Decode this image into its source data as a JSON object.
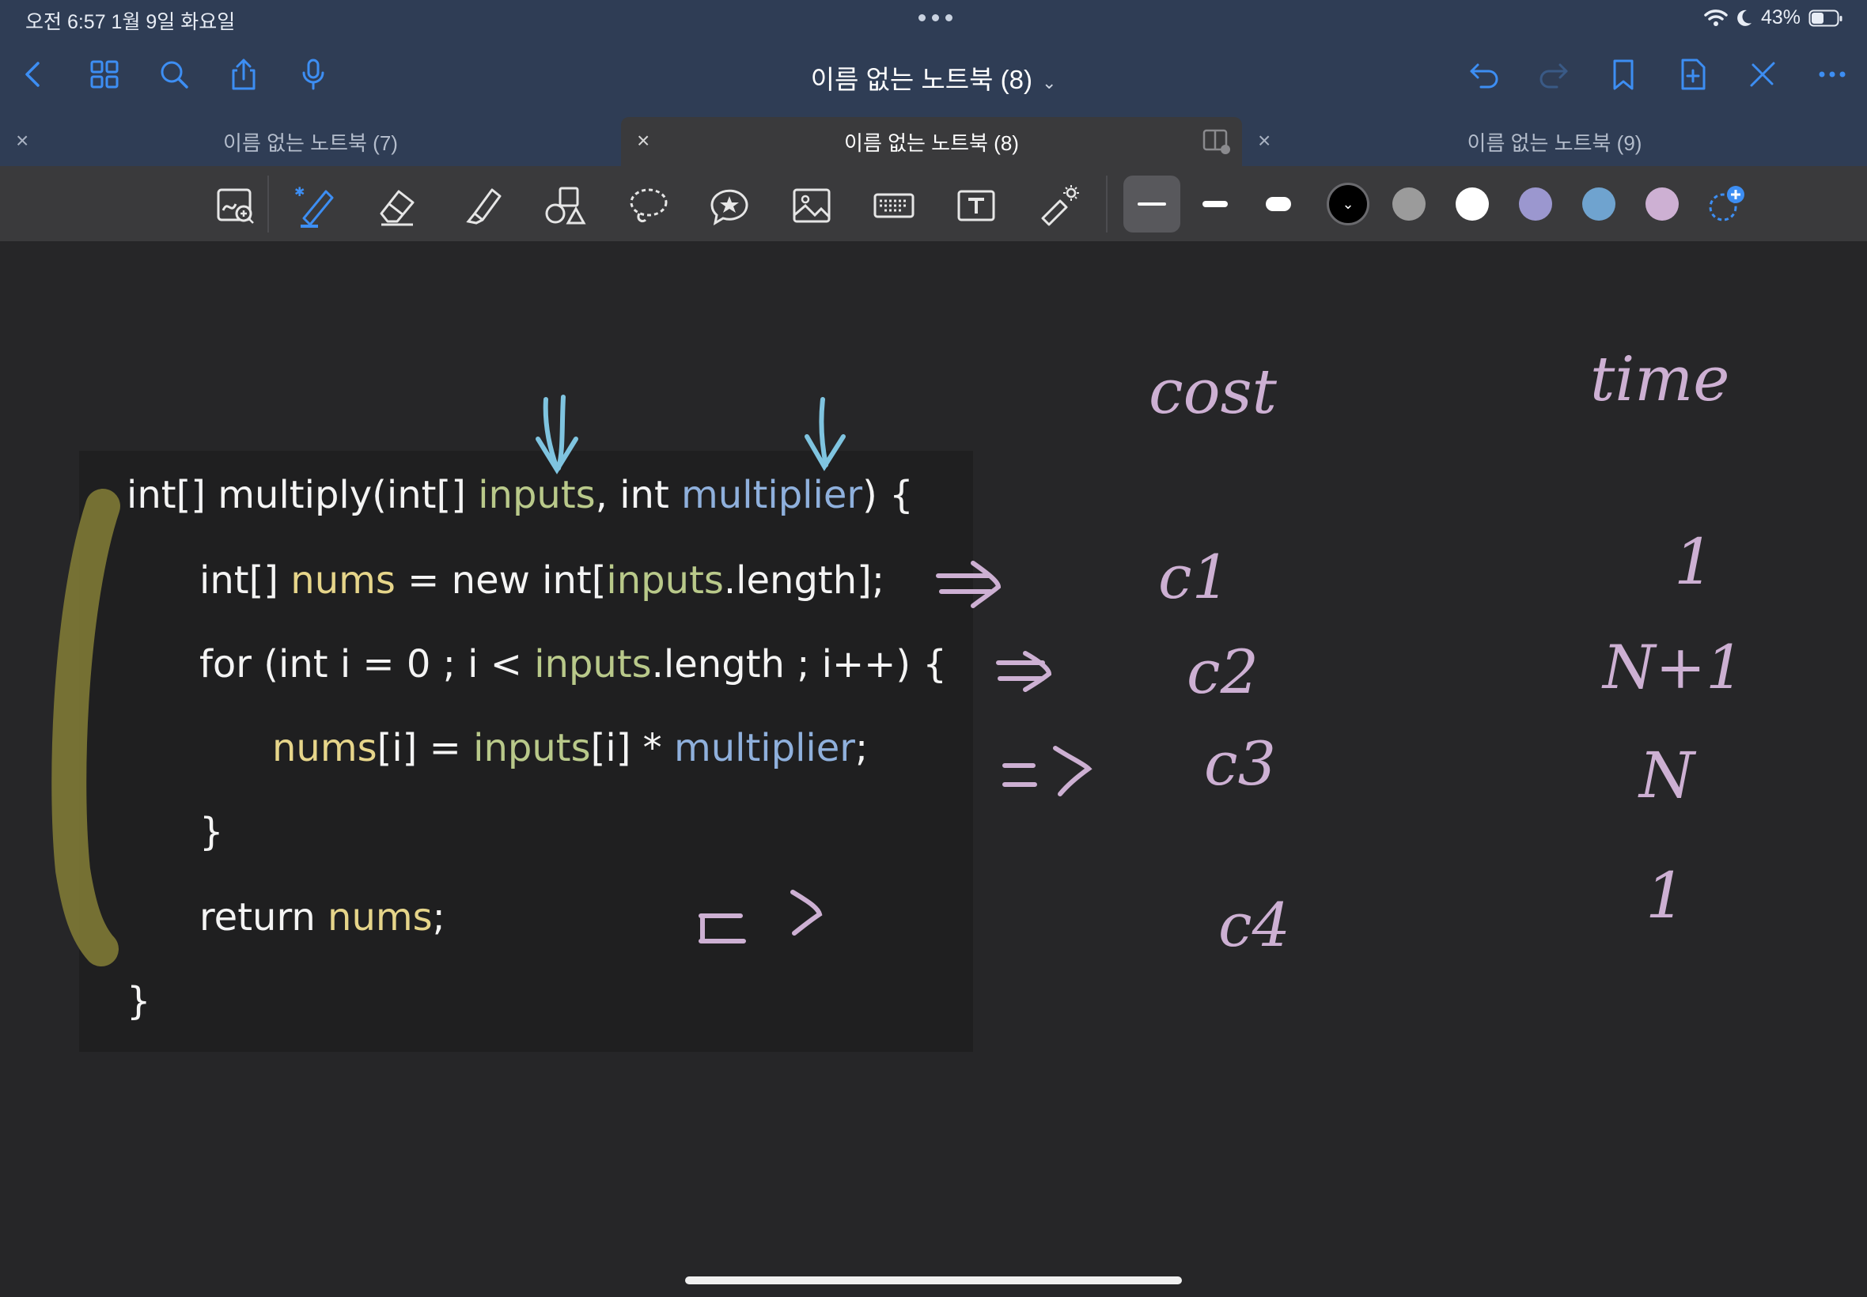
{
  "status_bar": {
    "time_date": "오전 6:57   1월 9일 화요일",
    "battery_percent": "43%"
  },
  "nav": {
    "document_title": "이름 없는 노트북 (8)"
  },
  "tabs": [
    {
      "label": "이름 없는 노트북 (7)",
      "active": false
    },
    {
      "label": "이름 없는 노트북 (8)",
      "active": true
    },
    {
      "label": "이름 없는 노트북 (9)",
      "active": false
    }
  ],
  "toolbar": {
    "tools": [
      "zoom-pen-icon",
      "pen-icon",
      "eraser-icon",
      "highlighter-icon",
      "shapes-icon",
      "lasso-icon",
      "sticker-icon",
      "image-icon",
      "keyboard-icon",
      "text-icon",
      "laser-pointer-icon"
    ],
    "stroke_sizes": [
      "thin",
      "medium",
      "thick"
    ],
    "colors": [
      "#000000",
      "#9b9b9b",
      "#ffffff",
      "#9b97cf",
      "#6fa3cf",
      "#cdb0d3"
    ]
  },
  "code": {
    "line1": {
      "a": "int[] multiply(int[] ",
      "b": "inputs",
      "c": ", int ",
      "d": "multiplier",
      "e": ") {"
    },
    "line2": {
      "a": "int[] ",
      "b": "nums",
      "c": " = new int[",
      "d": "inputs",
      "e": ".length];"
    },
    "line3": {
      "a": "for (int i = 0 ; i < ",
      "b": "inputs",
      "c": ".length ; i++) {"
    },
    "line4": {
      "a": "nums",
      "b": "[i] = ",
      "c": "inputs",
      "d": "[i] * ",
      "e": "multiplier",
      "f": ";"
    },
    "line5": "}",
    "line6": {
      "a": "return ",
      "b": "nums",
      "c": ";"
    },
    "line7": "}"
  },
  "handwriting": {
    "cost_header": "cost",
    "time_header": "time",
    "costs": [
      "c1",
      "c2",
      "c3",
      "c4"
    ],
    "times": [
      "1",
      "N+1",
      "N",
      "1"
    ]
  }
}
